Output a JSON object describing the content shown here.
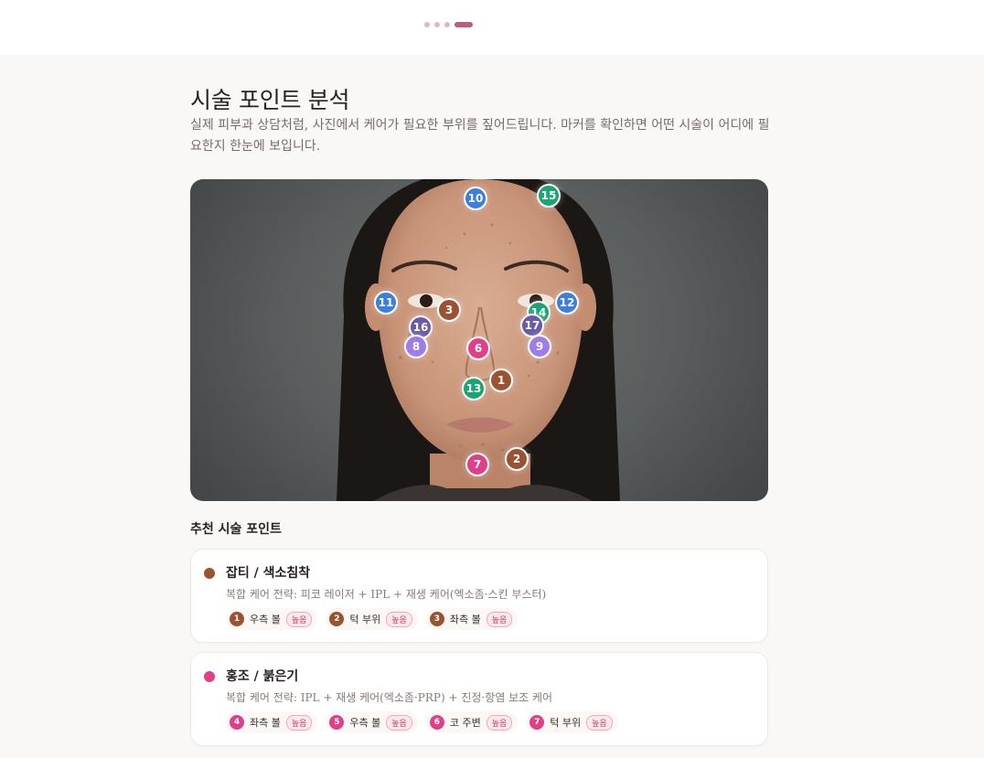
{
  "progress": {
    "steps": 4,
    "active": 4
  },
  "header": {
    "title": "시술 포인트 분석",
    "subtitle": "실제 피부과 상담처럼, 사진에서 케어가 필요한 부위를 짚어드립니다. 마커를 확인하면 어떤 시술이 어디에 필요한지 한눈에 보입니다."
  },
  "colors": {
    "brown": "#9a5230",
    "pink": "#e0408a",
    "blue": "#3b7fe0",
    "green": "#18a672",
    "lavender": "#9f7ce8",
    "purple": "#6a5aa8"
  },
  "markers": [
    {
      "label": "10",
      "color": "#3b7fe0"
    },
    {
      "label": "15",
      "color": "#18a672"
    },
    {
      "label": "11",
      "color": "#3b7fe0"
    },
    {
      "label": "3",
      "color": "#9a5230"
    },
    {
      "label": "14",
      "color": "#18a672"
    },
    {
      "label": "12",
      "color": "#3b7fe0"
    },
    {
      "label": "16",
      "color": "#6a5aa8"
    },
    {
      "label": "17",
      "color": "#6a5aa8"
    },
    {
      "label": "8",
      "color": "#9f7ce8"
    },
    {
      "label": "6",
      "color": "#e0408a"
    },
    {
      "label": "9",
      "color": "#9f7ce8"
    },
    {
      "label": "1",
      "color": "#9a5230"
    },
    {
      "label": "13",
      "color": "#18a672"
    },
    {
      "label": "7",
      "color": "#e0408a"
    },
    {
      "label": "2",
      "color": "#9a5230"
    }
  ],
  "section_title": "추천 시술 포인트",
  "cards": [
    {
      "title": "잡티 / 색소침착",
      "color": "#9a5230",
      "desc": "복합 케어 전략: 피코 레이저 + IPL + 재생 케어(엑소좀·스킨 부스터)",
      "points": [
        {
          "num": "1",
          "loc": "우측 볼",
          "level": "높음"
        },
        {
          "num": "2",
          "loc": "턱 부위",
          "level": "높음"
        },
        {
          "num": "3",
          "loc": "좌측 볼",
          "level": "높음"
        }
      ]
    },
    {
      "title": "홍조 / 붉은기",
      "color": "#e0408a",
      "desc": "복합 케어 전략: IPL + 재생 케어(엑소좀·PRP) + 진정·항염 보조 케어",
      "points": [
        {
          "num": "4",
          "loc": "좌측 볼",
          "level": "높음"
        },
        {
          "num": "5",
          "loc": "우측 볼",
          "level": "높음"
        },
        {
          "num": "6",
          "loc": "코 주변",
          "level": "높음"
        },
        {
          "num": "7",
          "loc": "턱 부위",
          "level": "높음"
        }
      ]
    }
  ]
}
